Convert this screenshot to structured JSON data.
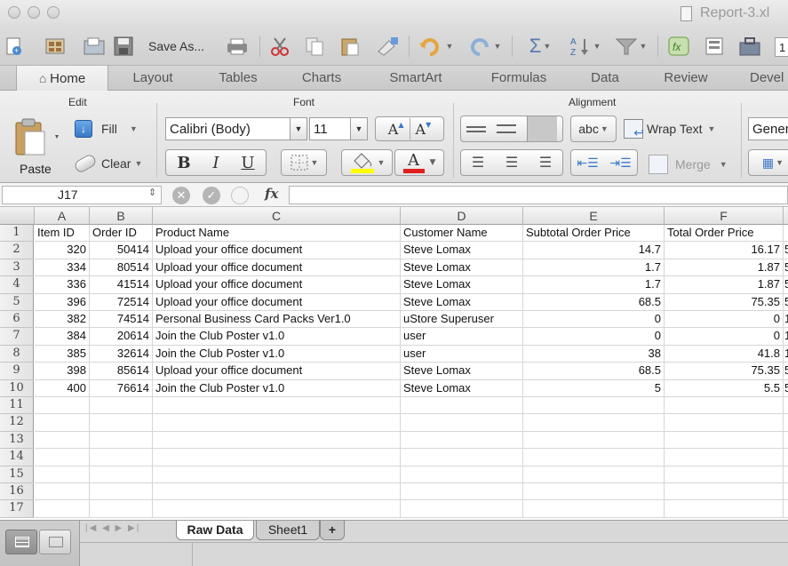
{
  "window": {
    "title": "Report-3.xl"
  },
  "toolbar": {
    "save_as_label": "Save As...",
    "icons": [
      "new-icon",
      "templates-icon",
      "open-icon",
      "save-icon",
      "print-icon",
      "cut-icon",
      "copy-icon",
      "paste-icon",
      "format-painter-icon",
      "undo-icon",
      "redo-icon",
      "autosum-icon",
      "sort-icon",
      "filter-icon",
      "function-icon",
      "show-icon",
      "toolbox-icon"
    ]
  },
  "ribbon_tabs": [
    "Home",
    "Layout",
    "Tables",
    "Charts",
    "SmartArt",
    "Formulas",
    "Data",
    "Review",
    "Devel"
  ],
  "ribbon": {
    "edit": {
      "title": "Edit",
      "paste_label": "Paste",
      "fill_label": "Fill",
      "clear_label": "Clear"
    },
    "font": {
      "title": "Font",
      "font_name": "Calibri (Body)",
      "font_size": "11",
      "bold": "B",
      "italic": "I",
      "underline": "U",
      "grow": "A",
      "shrink": "A",
      "font_color_letter": "A",
      "highlight_color": "#ffff00",
      "font_color": "#e02020"
    },
    "alignment": {
      "title": "Alignment",
      "abc_label": "abc",
      "wrap_label": "Wrap Text",
      "merge_label": "Merge"
    },
    "number": {
      "format_value": "Gener"
    }
  },
  "formula_bar": {
    "cell_ref": "J17",
    "fx_label": "fx",
    "content": ""
  },
  "sheet": {
    "columns": [
      "A",
      "B",
      "C",
      "D",
      "E",
      "F"
    ],
    "headers": [
      "Item ID",
      "Order ID",
      "Product Name",
      "Customer Name",
      "Subtotal Order Price",
      "Total Order Price"
    ],
    "rows": [
      [
        "320",
        "50414",
        "Upload your office document",
        "Steve Lomax",
        "14.7",
        "16.17"
      ],
      [
        "334",
        "80514",
        "Upload your office document",
        "Steve Lomax",
        "1.7",
        "1.87"
      ],
      [
        "336",
        "41514",
        "Upload your office document",
        "Steve Lomax",
        "1.7",
        "1.87"
      ],
      [
        "396",
        "72514",
        "Upload your office document",
        "Steve Lomax",
        "68.5",
        "75.35"
      ],
      [
        "382",
        "74514",
        "Personal Business Card Packs Ver1.0",
        "uStore Superuser",
        "0",
        "0"
      ],
      [
        "384",
        "20614",
        "Join the Club Poster v1.0",
        "user",
        "0",
        "0"
      ],
      [
        "385",
        "32614",
        "Join the Club Poster v1.0",
        "user",
        "38",
        "41.8"
      ],
      [
        "398",
        "85614",
        "Upload your office document",
        "Steve Lomax",
        "68.5",
        "75.35"
      ],
      [
        "400",
        "76614",
        "Join the Club Poster v1.0",
        "Steve Lomax",
        "5",
        "5.5"
      ]
    ],
    "overflow_g": [
      "5",
      "5",
      "5",
      "5",
      "1",
      "1",
      "1",
      "5",
      "5"
    ],
    "row_numbers": [
      "1",
      "2",
      "3",
      "4",
      "5",
      "6",
      "7",
      "8",
      "9",
      "10",
      "11",
      "12",
      "13",
      "14",
      "15",
      "16",
      "17"
    ]
  },
  "sheet_tabs": [
    "Raw Data",
    "Sheet1"
  ],
  "add_sheet_label": "+",
  "colors": {
    "grid_line": "#d6d6d6",
    "active_tab": "#ffffff",
    "highlight": "#ffff00",
    "font_red": "#e02020"
  }
}
